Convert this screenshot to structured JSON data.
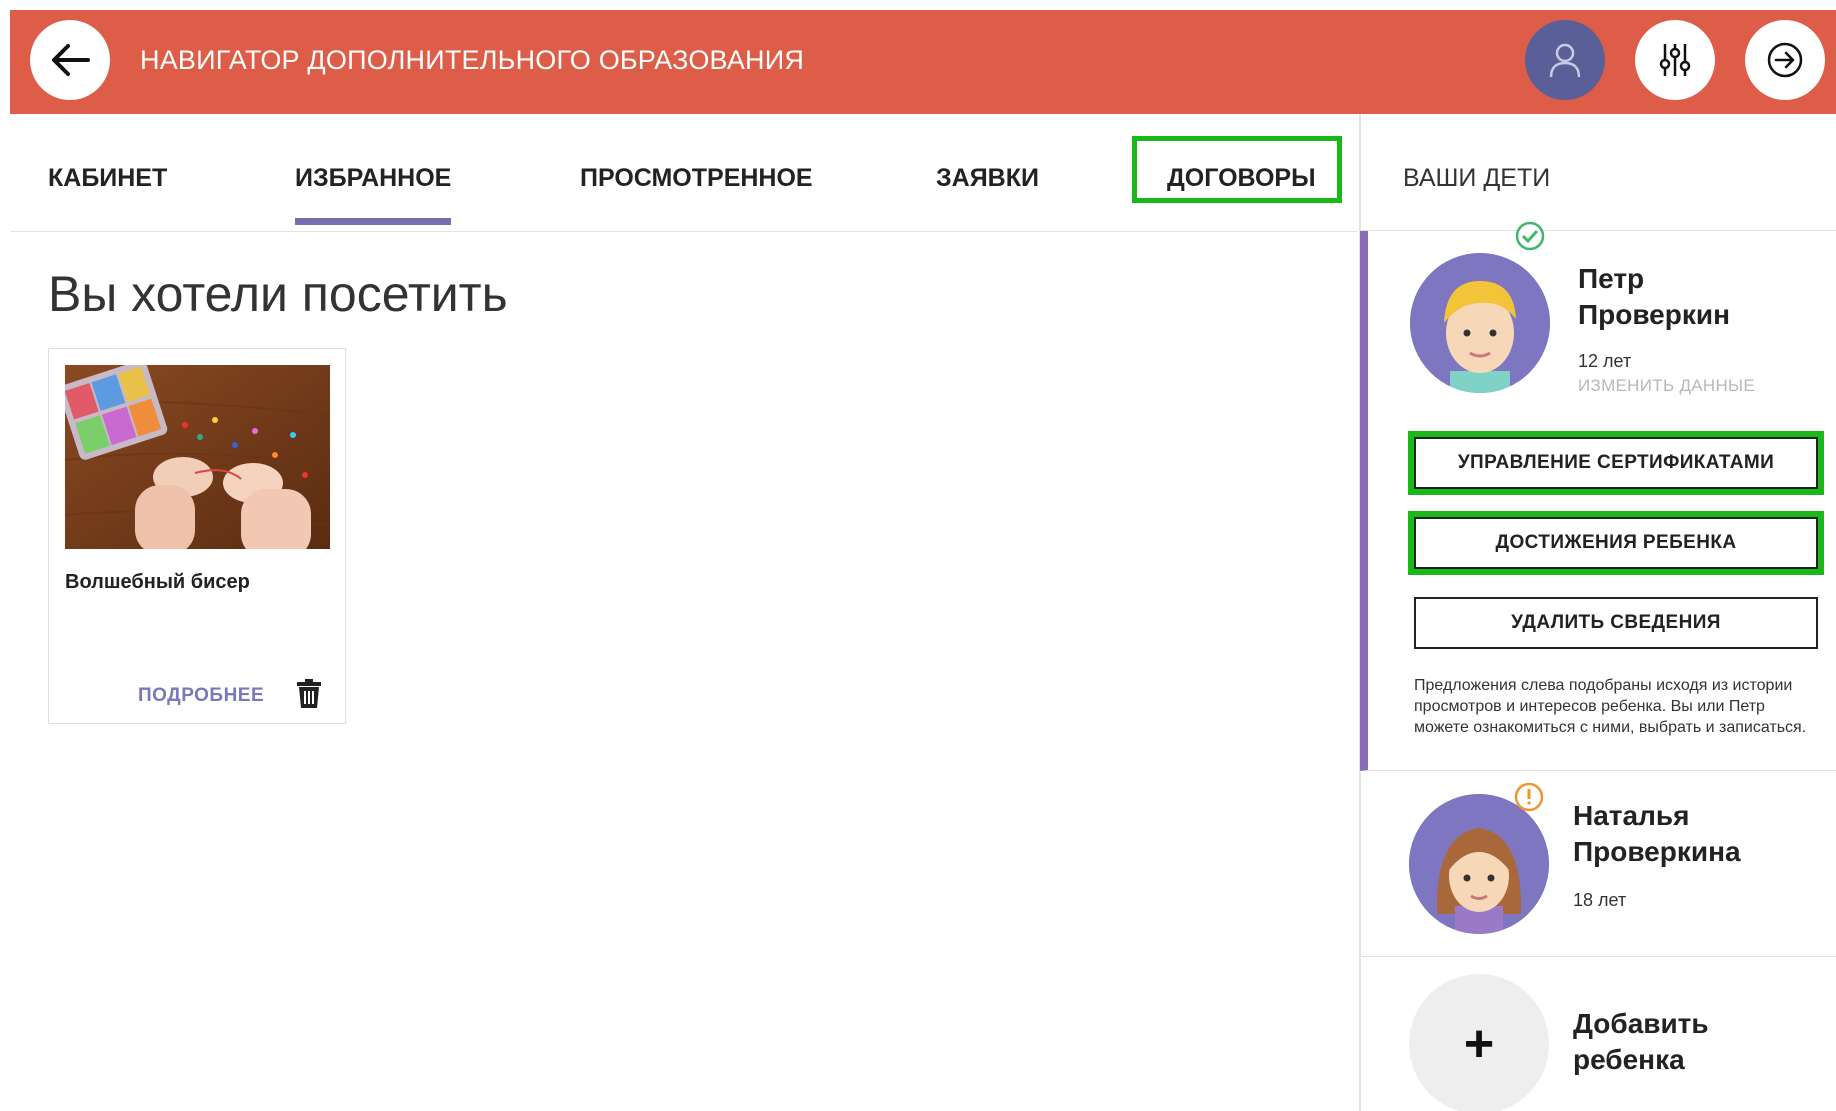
{
  "header": {
    "app_title": "НАВИГАТОР ДОПОЛНИТЕЛЬНОГО ОБРАЗОВАНИЯ",
    "accent_color": "#de5d48"
  },
  "tabs": [
    {
      "label": "КАБИНЕТ"
    },
    {
      "label": "ИЗБРАННОЕ",
      "active": true
    },
    {
      "label": "ПРОСМОТРЕННОЕ"
    },
    {
      "label": "ЗАЯВКИ"
    },
    {
      "label": "ДОГОВОРЫ",
      "highlighted": true
    }
  ],
  "main": {
    "section_title": "Вы хотели посетить",
    "cards": [
      {
        "name": "Волшебный бисер",
        "more_label": "ПОДРОБНЕЕ"
      }
    ]
  },
  "sidebar": {
    "title": "ВАШИ ДЕТИ",
    "children": [
      {
        "first_name": "Петр",
        "last_name": "Проверкин",
        "age": "12 лет",
        "edit_label": "ИЗМЕНИТЬ ДАННЫЕ",
        "status": "check",
        "buttons": {
          "certificates": "УПРАВЛЕНИЕ СЕРТИФИКАТАМИ",
          "achievements": "ДОСТИЖЕНИЯ РЕБЕНКА",
          "delete": "УДАЛИТЬ СВЕДЕНИЯ"
        },
        "hint": "Предложения слева подобраны исходя из истории просмотров и интересов ребенка. Вы или Петр можете ознакомиться с ними, выбрать и записаться."
      },
      {
        "first_name": "Наталья",
        "last_name": "Проверкина",
        "age": "18 лет",
        "status": "warning"
      }
    ],
    "add_child": {
      "line1": "Добавить",
      "line2": "ребенка"
    }
  }
}
